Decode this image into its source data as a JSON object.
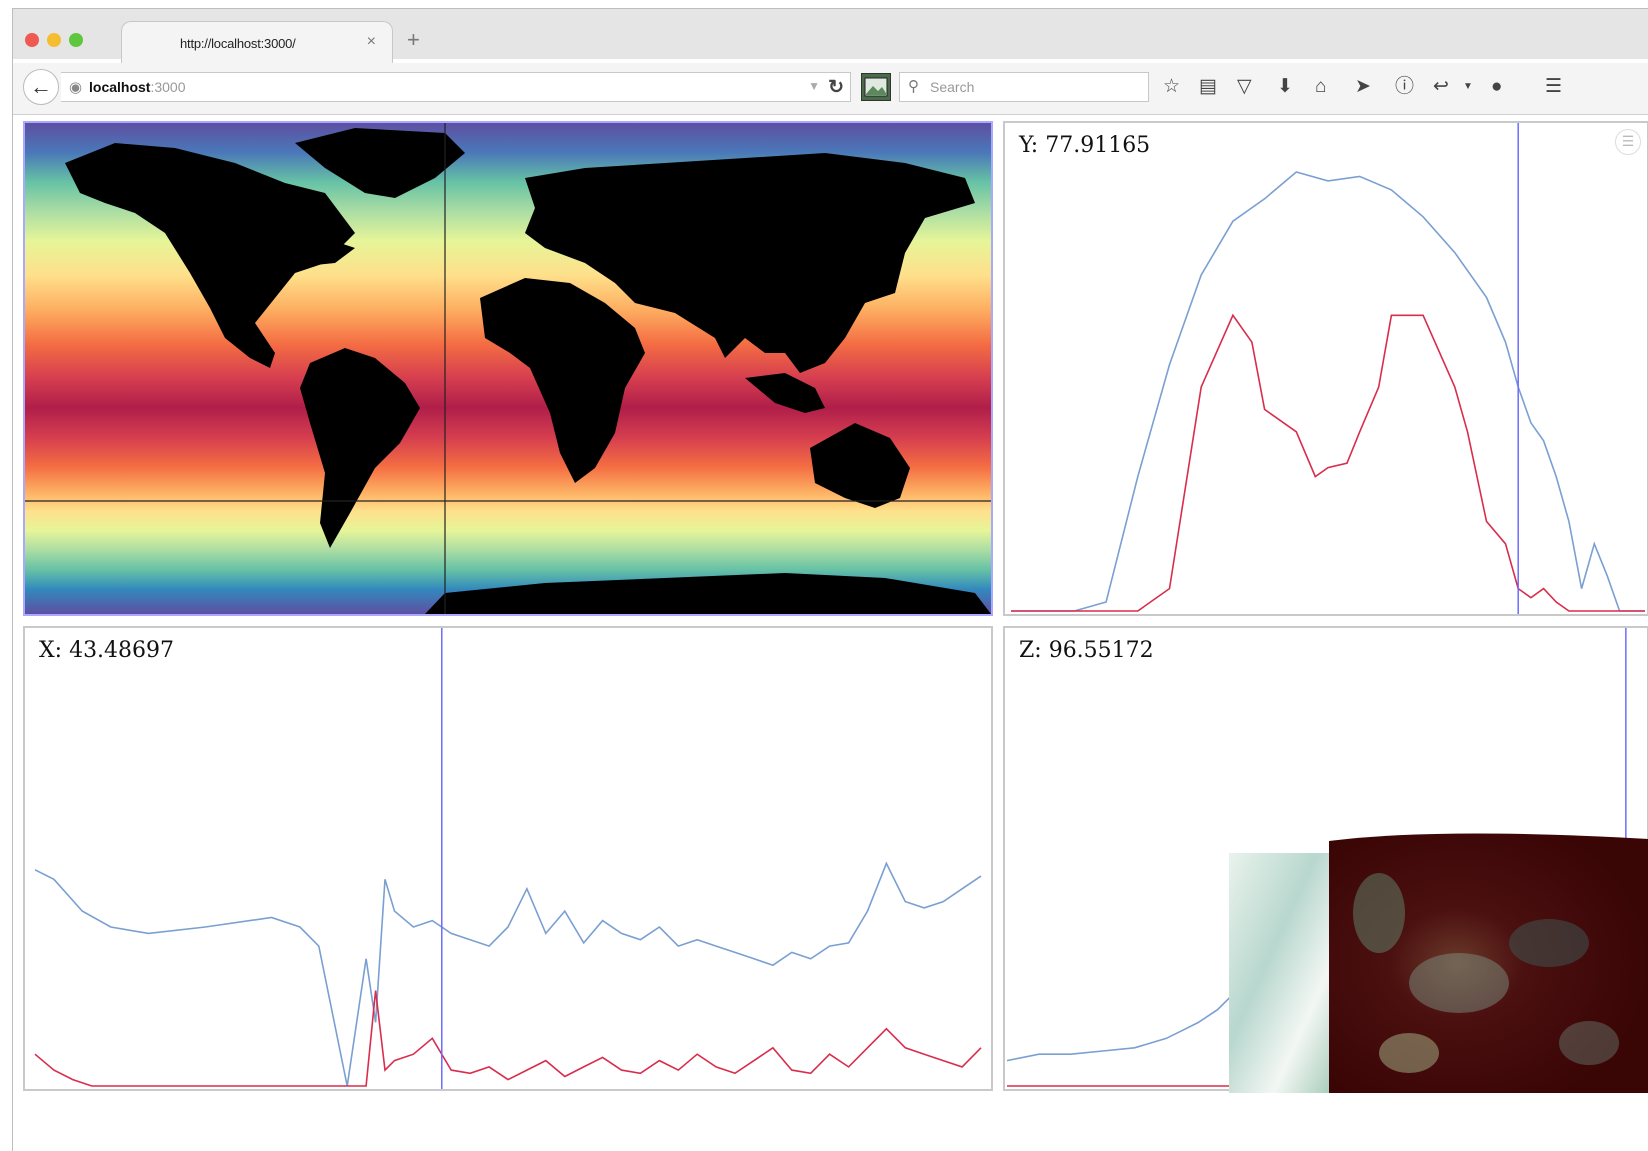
{
  "browser": {
    "tab_title": "http://localhost:3000/",
    "tab_close": "×",
    "new_tab": "+",
    "url_host": "localhost",
    "url_port": ":3000",
    "search_placeholder": "Search",
    "traffic_colors": [
      "#ee5a52",
      "#f5bd2f",
      "#5fc73f"
    ]
  },
  "panels": {
    "map": {
      "colormap": "spectral",
      "land_color": "#000000"
    },
    "y_profile": {
      "label": "Y: 77.91165"
    },
    "x_profile": {
      "label": "X: 43.48697"
    },
    "z_profile": {
      "label": "Z: 96.55172"
    }
  },
  "colors": {
    "blue_series": "#7a9fd1",
    "red_series": "#d92d4c",
    "cursor": "#6c6cff",
    "panel_border": "#c9c9c9"
  },
  "chart_data": [
    {
      "type": "line",
      "panel": "y_profile",
      "title": "Y: 77.91165",
      "xlim": [
        0,
        100
      ],
      "ylim": [
        0,
        100
      ],
      "cursor_x": 80,
      "series": [
        {
          "color": "#7a9fd1",
          "x": [
            0,
            5,
            10,
            15,
            20,
            25,
            30,
            35,
            40,
            45,
            50,
            55,
            60,
            65,
            70,
            75,
            78,
            80,
            82,
            84,
            86,
            88,
            90,
            92,
            94,
            96,
            98,
            100
          ],
          "y": [
            0,
            0,
            0,
            2,
            30,
            55,
            75,
            87,
            92,
            98,
            96,
            97,
            94,
            88,
            80,
            70,
            60,
            50,
            42,
            38,
            30,
            20,
            5,
            15,
            8,
            0,
            0,
            0
          ]
        },
        {
          "color": "#d92d4c",
          "x": [
            0,
            10,
            20,
            22,
            25,
            30,
            35,
            38,
            40,
            45,
            48,
            50,
            53,
            55,
            58,
            60,
            65,
            70,
            72,
            75,
            78,
            80,
            82,
            84,
            86,
            88,
            90,
            100
          ],
          "y": [
            0,
            0,
            0,
            2,
            5,
            50,
            66,
            60,
            45,
            40,
            30,
            32,
            33,
            40,
            50,
            66,
            66,
            50,
            40,
            20,
            15,
            5,
            3,
            5,
            2,
            0,
            0,
            0
          ]
        }
      ]
    },
    {
      "type": "line",
      "panel": "x_profile",
      "title": "X: 43.48697",
      "xlim": [
        0,
        100
      ],
      "ylim": [
        0,
        100
      ],
      "cursor_x": 43,
      "series": [
        {
          "color": "#7a9fd1",
          "x": [
            0,
            2,
            5,
            8,
            12,
            18,
            25,
            28,
            30,
            33,
            35,
            36,
            37,
            38,
            40,
            42,
            44,
            46,
            48,
            50,
            52,
            54,
            56,
            58,
            60,
            62,
            64,
            66,
            68,
            70,
            72,
            74,
            76,
            78,
            80,
            82,
            84,
            86,
            88,
            90,
            92,
            94,
            96,
            98,
            100
          ],
          "y": [
            68,
            65,
            55,
            50,
            48,
            50,
            53,
            50,
            44,
            0,
            40,
            20,
            65,
            55,
            50,
            52,
            48,
            46,
            44,
            50,
            62,
            48,
            55,
            45,
            52,
            48,
            46,
            50,
            44,
            46,
            44,
            42,
            40,
            38,
            42,
            40,
            44,
            45,
            55,
            70,
            58,
            56,
            58,
            62,
            66
          ]
        },
        {
          "color": "#d92d4c",
          "x": [
            0,
            2,
            4,
            6,
            10,
            20,
            30,
            35,
            36,
            37,
            38,
            40,
            42,
            44,
            46,
            48,
            50,
            52,
            54,
            56,
            58,
            60,
            62,
            64,
            66,
            68,
            70,
            72,
            74,
            76,
            78,
            80,
            82,
            84,
            86,
            88,
            90,
            92,
            94,
            96,
            98,
            100
          ],
          "y": [
            10,
            5,
            2,
            0,
            0,
            0,
            0,
            0,
            30,
            5,
            8,
            10,
            15,
            5,
            4,
            6,
            2,
            5,
            8,
            3,
            6,
            9,
            5,
            4,
            8,
            5,
            10,
            6,
            4,
            8,
            12,
            5,
            4,
            10,
            6,
            12,
            18,
            12,
            10,
            8,
            6,
            12
          ]
        }
      ]
    },
    {
      "type": "line",
      "panel": "z_profile",
      "title": "Z: 96.55172",
      "xlim": [
        0,
        100
      ],
      "ylim": [
        0,
        100
      ],
      "cursor_x": 97,
      "series": [
        {
          "color": "#7a9fd1",
          "x": [
            0,
            5,
            10,
            15,
            20,
            25,
            28,
            30,
            33,
            35,
            38
          ],
          "y": [
            8,
            10,
            10,
            11,
            12,
            15,
            18,
            20,
            24,
            28,
            32
          ]
        },
        {
          "color": "#d92d4c",
          "x": [
            0,
            10,
            20,
            30,
            40
          ],
          "y": [
            0,
            0,
            0,
            0,
            0
          ]
        }
      ]
    }
  ]
}
